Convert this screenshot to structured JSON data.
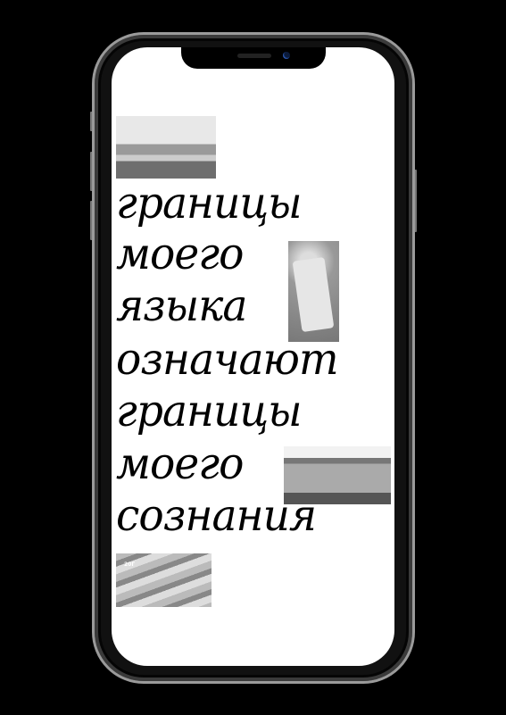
{
  "poster": {
    "lines": [
      "границы",
      "моего",
      "языка",
      "означают",
      "границы",
      "моего",
      "сознания"
    ],
    "euro_caption": "20Г"
  },
  "colors": {
    "background": "#000000",
    "screen": "#ffffff",
    "text": "#000000"
  }
}
